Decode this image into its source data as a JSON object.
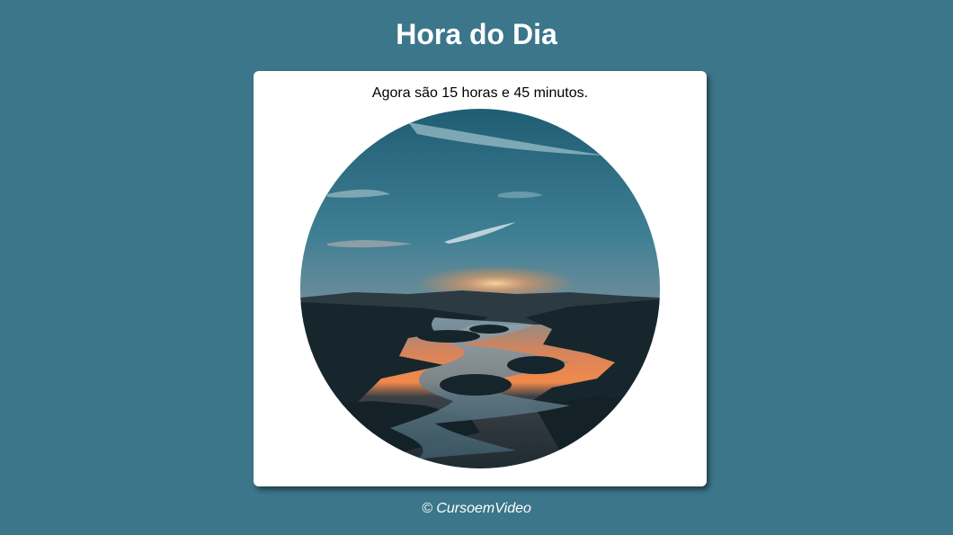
{
  "header": {
    "title": "Hora do Dia"
  },
  "main": {
    "message": "Agora são 15 horas e 45 minutos.",
    "image_icon": "sunset-landscape-photo"
  },
  "footer": {
    "text": "© CursoemVideo"
  },
  "colors": {
    "background": "#3b768b",
    "card": "#ffffff",
    "title": "#ffffff"
  }
}
